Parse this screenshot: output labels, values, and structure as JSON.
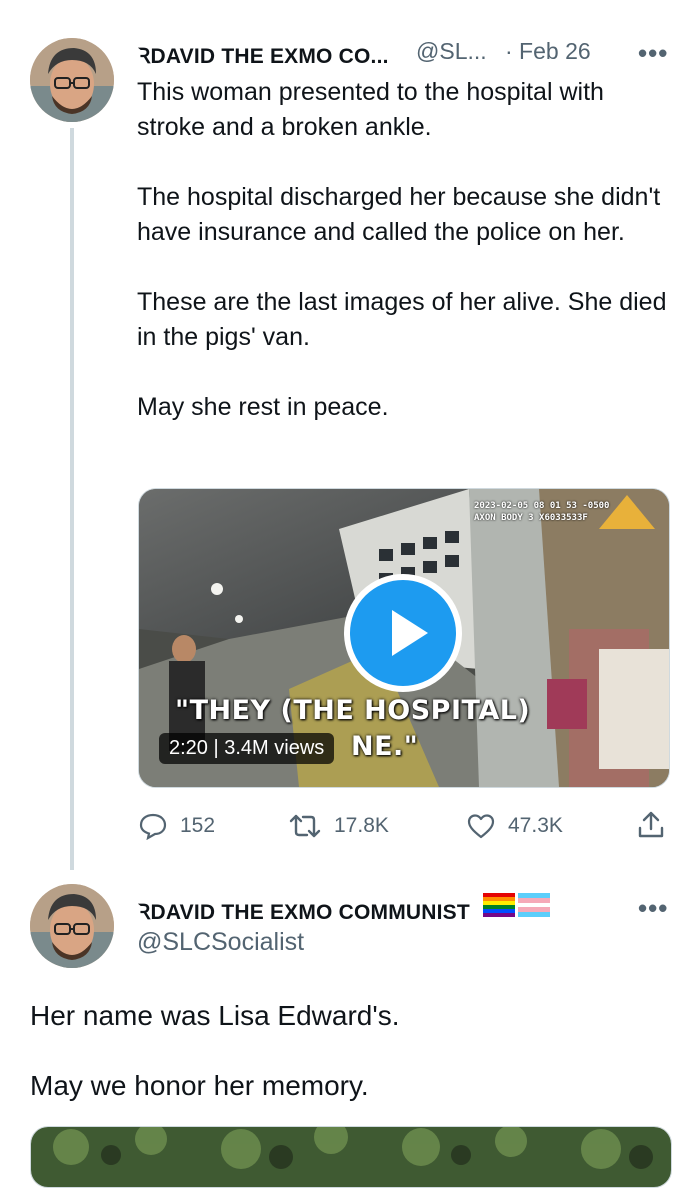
{
  "tweet1": {
    "display_name": "ꝚDAVID THE EXMO CO...",
    "handle": "@SL...",
    "date": "· Feb 26",
    "more": "•••",
    "text": "This woman presented to the hospital with stroke and a broken ankle.\n\nThe hospital discharged her because she didn't have insurance and called the police on her.\n\nThese are the last images of her alive. She died in the pigs' van.\n\nMay she rest in peace.",
    "video": {
      "timestamp_line1": "2023-02-05 08 01 53 -0500",
      "timestamp_line2": "AXON BODY 3 X6033533F",
      "caption_line1": "\"THEY (THE HOSPITAL)",
      "caption_line2": "NE.\"",
      "duration_views": "2:20 | 3.4M views"
    },
    "actions": {
      "replies": "152",
      "retweets": "17.8K",
      "likes": "47.3K"
    }
  },
  "tweet2": {
    "display_name": "ꝚDAVID THE EXMO COMMUNIST",
    "handle": "@SLCSocialist",
    "more": "•••",
    "text_line1": "Her name was Lisa Edward's.",
    "text_line2": "May we honor her memory."
  },
  "colors": {
    "accent": "#1d9bf0",
    "secondary_text": "#536471",
    "thread_line": "#cfd9de"
  },
  "icons": [
    "reply-icon",
    "retweet-icon",
    "like-icon",
    "share-icon",
    "play-icon",
    "rainbow-flag-icon",
    "trans-flag-icon"
  ]
}
